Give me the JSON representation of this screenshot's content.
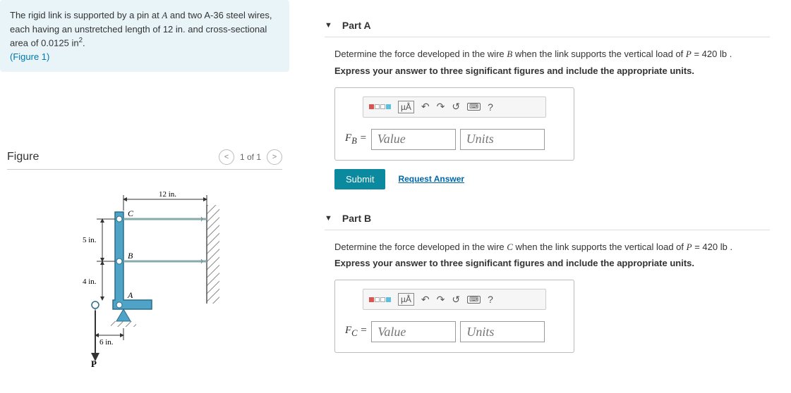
{
  "problem": {
    "text_1": "The rigid link is supported by a pin at ",
    "var_A": "A",
    "text_2": " and two A-36 steel wires, each having an unstretched length of 12 ",
    "unit_in": "in.",
    "text_3": " and cross-sectional area of 0.0125 ",
    "unit_in2": "in",
    "sup2": "2",
    "period": ".",
    "figure_link": "(Figure 1)"
  },
  "figure": {
    "title": "Figure",
    "counter": "1 of 1",
    "dims": {
      "top": "12 in.",
      "c_label": "C",
      "five": "5 in.",
      "b_label": "B",
      "four": "4 in.",
      "a_label": "A",
      "six": "6 in.",
      "p_label": "P"
    }
  },
  "toolbar": {
    "units_label": "µÅ",
    "help": "?"
  },
  "partA": {
    "title": "Part A",
    "prompt_1": "Determine the force developed in the wire ",
    "var_B": "B",
    "prompt_2": " when the link supports the vertical load of ",
    "var_P": "P",
    "eq": " = 420  ",
    "unit_lb": "lb",
    "period": " .",
    "instruct": "Express your answer to three significant figures and include the appropriate units.",
    "var_label": "F",
    "var_sub": "B",
    "equals": " = ",
    "value_ph": "Value",
    "units_ph": "Units",
    "submit": "Submit",
    "request": "Request Answer"
  },
  "partB": {
    "title": "Part B",
    "prompt_1": "Determine the force developed in the wire ",
    "var_C": "C",
    "prompt_2": " when the link supports the vertical load of ",
    "var_P": "P",
    "eq": " = 420  ",
    "unit_lb": "lb",
    "period": " .",
    "instruct": "Express your answer to three significant figures and include the appropriate units.",
    "var_label": "F",
    "var_sub": "C",
    "equals": " = ",
    "value_ph": "Value",
    "units_ph": "Units"
  }
}
